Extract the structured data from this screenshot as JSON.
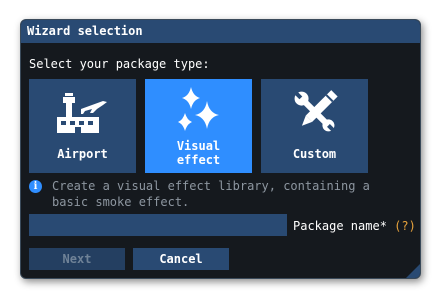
{
  "window": {
    "title": "Wizard selection"
  },
  "prompt": "Select your package type:",
  "tiles": [
    {
      "label": "Airport",
      "icon": "airport-icon",
      "selected": false
    },
    {
      "label": "Visual effect",
      "icon": "sparkles-icon",
      "selected": true
    },
    {
      "label": "Custom",
      "icon": "tools-icon",
      "selected": false
    }
  ],
  "info": {
    "icon": "info-icon",
    "line1": "Create a visual effect library, containing a",
    "line2": "basic smoke effect."
  },
  "package_name": {
    "value": "",
    "label": "Package name*",
    "help": "(?)"
  },
  "buttons": {
    "next": "Next",
    "cancel": "Cancel"
  },
  "colors": {
    "window_bg": "#15191e",
    "title_bg": "#294a73",
    "tile_bg": "#294a73",
    "tile_selected": "#2f8eff",
    "info_text": "#8d96a0",
    "help_mark": "#e6a23c"
  }
}
